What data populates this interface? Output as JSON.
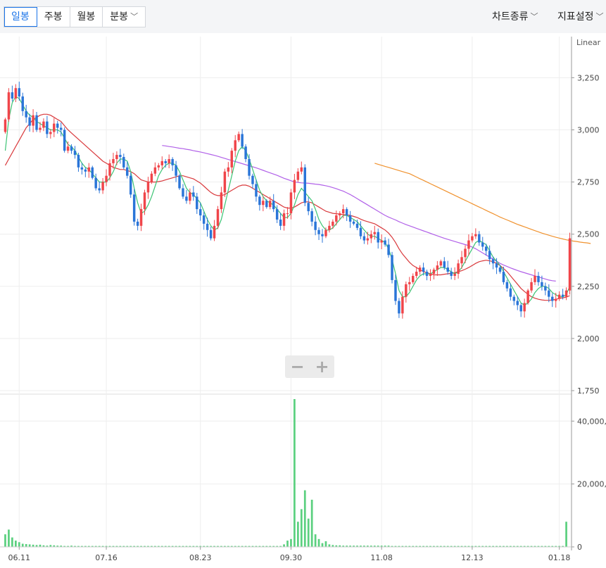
{
  "tabs": [
    {
      "label": "일봉",
      "active": true
    },
    {
      "label": "주봉",
      "active": false
    },
    {
      "label": "월봉",
      "active": false
    },
    {
      "label": "분봉",
      "active": false,
      "dropdown": true
    }
  ],
  "right_menu": {
    "chart_type": "차트종류",
    "indicator": "지표설정"
  },
  "zoom": {
    "minus": "−",
    "plus": "+"
  },
  "colors": {
    "up": "#f0454a",
    "down": "#2a75d8",
    "ma5": "#3cc474",
    "ma20": "#d9393c",
    "ma60": "#b161e8",
    "ma120": "#f0922e",
    "volume": "#5bd07f",
    "grid": "#eeeeee"
  },
  "chart_data": {
    "type": "candlestick",
    "scale_label": "Linear",
    "price_axis": {
      "ticks": [
        "3,250",
        "3,000",
        "2,750",
        "2,500",
        "2,250",
        "2,000",
        "1,750"
      ],
      "tick_values": [
        3250,
        3000,
        2750,
        2500,
        2250,
        2000,
        1750
      ],
      "ylim": [
        1750,
        3420
      ]
    },
    "volume_axis": {
      "ticks": [
        "40,000,000",
        "20,000,000",
        "0"
      ],
      "tick_values": [
        40000000,
        20000000,
        0
      ],
      "ylim": [
        0,
        47000000
      ]
    },
    "x_ticks": [
      {
        "label": "06.11",
        "index": 4
      },
      {
        "label": "07.16",
        "index": 29
      },
      {
        "label": "08.23",
        "index": 56
      },
      {
        "label": "09.30",
        "index": 82
      },
      {
        "label": "11.08",
        "index": 108
      },
      {
        "label": "12.13",
        "index": 134
      },
      {
        "label": "01.18",
        "index": 159
      }
    ],
    "closes": [
      3050,
      3180,
      3150,
      3200,
      3160,
      3090,
      3060,
      3020,
      3070,
      3000,
      3010,
      3040,
      2980,
      2990,
      3030,
      3010,
      3000,
      2900,
      2920,
      2900,
      2880,
      2820,
      2810,
      2800,
      2820,
      2770,
      2720,
      2710,
      2750,
      2780,
      2840,
      2860,
      2880,
      2870,
      2820,
      2780,
      2690,
      2560,
      2540,
      2620,
      2700,
      2750,
      2790,
      2820,
      2830,
      2850,
      2840,
      2860,
      2830,
      2780,
      2720,
      2680,
      2660,
      2700,
      2680,
      2620,
      2590,
      2550,
      2520,
      2480,
      2540,
      2620,
      2700,
      2800,
      2820,
      2900,
      2950,
      2980,
      2920,
      2860,
      2780,
      2740,
      2680,
      2640,
      2660,
      2630,
      2660,
      2620,
      2570,
      2540,
      2600,
      2600,
      2700,
      2760,
      2800,
      2820,
      2650,
      2610,
      2560,
      2520,
      2500,
      2490,
      2520,
      2540,
      2560,
      2590,
      2600,
      2620,
      2590,
      2560,
      2550,
      2530,
      2490,
      2470,
      2480,
      2500,
      2510,
      2460,
      2470,
      2450,
      2400,
      2280,
      2180,
      2120,
      2200,
      2260,
      2270,
      2300,
      2320,
      2340,
      2320,
      2300,
      2310,
      2330,
      2350,
      2370,
      2340,
      2320,
      2300,
      2310,
      2360,
      2390,
      2430,
      2470,
      2490,
      2500,
      2460,
      2440,
      2420,
      2380,
      2360,
      2340,
      2320,
      2270,
      2240,
      2200,
      2180,
      2160,
      2130,
      2170,
      2230,
      2270,
      2300,
      2270,
      2250,
      2230,
      2200,
      2180,
      2190,
      2210,
      2200,
      2230,
      2480
    ],
    "ma5": [
      2900,
      3050,
      3130,
      3160,
      3150,
      3120,
      3090,
      3070,
      3060,
      3040,
      3030,
      3020,
      3010,
      3000,
      3000,
      3000,
      2990,
      2960,
      2930,
      2920,
      2900,
      2870,
      2840,
      2820,
      2810,
      2790,
      2770,
      2750,
      2750,
      2750,
      2770,
      2800,
      2840,
      2860,
      2860,
      2850,
      2800,
      2720,
      2650,
      2600,
      2610,
      2640,
      2680,
      2730,
      2780,
      2810,
      2830,
      2840,
      2840,
      2830,
      2800,
      2760,
      2720,
      2700,
      2690,
      2670,
      2650,
      2610,
      2570,
      2540,
      2520,
      2530,
      2570,
      2640,
      2710,
      2780,
      2850,
      2900,
      2920,
      2900,
      2860,
      2810,
      2760,
      2710,
      2680,
      2660,
      2650,
      2640,
      2620,
      2600,
      2580,
      2580,
      2600,
      2640,
      2690,
      2720,
      2700,
      2680,
      2660,
      2620,
      2570,
      2540,
      2520,
      2520,
      2530,
      2550,
      2570,
      2590,
      2590,
      2580,
      2570,
      2560,
      2540,
      2520,
      2500,
      2490,
      2490,
      2480,
      2470,
      2460,
      2430,
      2380,
      2310,
      2230,
      2200,
      2200,
      2220,
      2250,
      2280,
      2300,
      2310,
      2310,
      2310,
      2320,
      2330,
      2340,
      2340,
      2330,
      2320,
      2310,
      2320,
      2340,
      2370,
      2400,
      2430,
      2460,
      2470,
      2460,
      2450,
      2420,
      2390,
      2370,
      2350,
      2320,
      2290,
      2260,
      2230,
      2200,
      2170,
      2160,
      2170,
      2190,
      2220,
      2240,
      2250,
      2250,
      2240,
      2220,
      2210,
      2200,
      2200,
      2210,
      2250
    ],
    "ma20": [
      2830,
      2860,
      2890,
      2920,
      2950,
      2980,
      3010,
      3030,
      3050,
      3060,
      3070,
      3075,
      3075,
      3070,
      3060,
      3050,
      3040,
      3020,
      3000,
      2985,
      2970,
      2955,
      2940,
      2925,
      2910,
      2895,
      2880,
      2865,
      2850,
      2840,
      2830,
      2820,
      2815,
      2810,
      2810,
      2805,
      2800,
      2790,
      2775,
      2760,
      2755,
      2750,
      2750,
      2750,
      2752,
      2755,
      2760,
      2765,
      2770,
      2775,
      2780,
      2780,
      2775,
      2770,
      2765,
      2755,
      2745,
      2730,
      2715,
      2700,
      2690,
      2685,
      2685,
      2690,
      2700,
      2710,
      2720,
      2730,
      2735,
      2735,
      2730,
      2720,
      2710,
      2700,
      2690,
      2680,
      2670,
      2660,
      2650,
      2640,
      2630,
      2625,
      2625,
      2630,
      2640,
      2650,
      2655,
      2655,
      2650,
      2640,
      2630,
      2620,
      2610,
      2605,
      2600,
      2598,
      2596,
      2594,
      2592,
      2590,
      2585,
      2580,
      2572,
      2565,
      2560,
      2555,
      2550,
      2540,
      2530,
      2520,
      2505,
      2485,
      2460,
      2430,
      2405,
      2385,
      2365,
      2350,
      2340,
      2330,
      2320,
      2315,
      2310,
      2305,
      2305,
      2305,
      2308,
      2310,
      2312,
      2315,
      2320,
      2325,
      2332,
      2340,
      2350,
      2360,
      2368,
      2372,
      2375,
      2372,
      2368,
      2360,
      2350,
      2335,
      2320,
      2300,
      2280,
      2260,
      2240,
      2225,
      2212,
      2200,
      2193,
      2188,
      2185,
      2183,
      2183,
      2185,
      2188,
      2192,
      2195,
      2198,
      2205
    ],
    "ma60": [
      null,
      null,
      null,
      null,
      null,
      null,
      null,
      null,
      null,
      null,
      null,
      null,
      null,
      null,
      null,
      null,
      null,
      null,
      null,
      null,
      null,
      null,
      null,
      null,
      null,
      null,
      null,
      null,
      null,
      null,
      null,
      null,
      null,
      null,
      null,
      null,
      null,
      null,
      null,
      null,
      null,
      null,
      null,
      null,
      null,
      2925,
      2923,
      2920,
      2918,
      2915,
      2912,
      2910,
      2907,
      2904,
      2900,
      2897,
      2894,
      2890,
      2886,
      2882,
      2878,
      2873,
      2868,
      2863,
      2858,
      2853,
      2848,
      2843,
      2838,
      2833,
      2828,
      2823,
      2818,
      2812,
      2806,
      2800,
      2794,
      2788,
      2782,
      2775,
      2768,
      2762,
      2756,
      2750,
      2748,
      2746,
      2745,
      2744,
      2742,
      2740,
      2738,
      2735,
      2732,
      2728,
      2723,
      2718,
      2712,
      2706,
      2698,
      2690,
      2680,
      2670,
      2660,
      2650,
      2640,
      2630,
      2620,
      2610,
      2600,
      2590,
      2582,
      2575,
      2568,
      2560,
      2553,
      2546,
      2540,
      2534,
      2528,
      2522,
      2516,
      2510,
      2504,
      2498,
      2492,
      2486,
      2480,
      2475,
      2470,
      2465,
      2460,
      2455,
      2450,
      2445,
      2438,
      2430,
      2420,
      2410,
      2400,
      2390,
      2380,
      2370,
      2360,
      2352,
      2345,
      2338,
      2332,
      2326,
      2320,
      2315,
      2310,
      2305,
      2300,
      2295,
      2290,
      2285,
      2280,
      2277,
      2275
    ],
    "ma120": [
      null,
      null,
      null,
      null,
      null,
      null,
      null,
      null,
      null,
      null,
      null,
      null,
      null,
      null,
      null,
      null,
      null,
      null,
      null,
      null,
      null,
      null,
      null,
      null,
      null,
      null,
      null,
      null,
      null,
      null,
      null,
      null,
      null,
      null,
      null,
      null,
      null,
      null,
      null,
      null,
      null,
      null,
      null,
      null,
      null,
      null,
      null,
      null,
      null,
      null,
      null,
      null,
      null,
      null,
      null,
      null,
      null,
      null,
      null,
      null,
      null,
      null,
      null,
      null,
      null,
      null,
      null,
      null,
      null,
      null,
      null,
      null,
      null,
      null,
      null,
      null,
      null,
      null,
      null,
      null,
      null,
      null,
      null,
      null,
      null,
      null,
      null,
      null,
      null,
      null,
      null,
      null,
      null,
      null,
      null,
      null,
      null,
      null,
      null,
      null,
      null,
      null,
      null,
      null,
      null,
      null,
      2840,
      2835,
      2830,
      2825,
      2820,
      2815,
      2810,
      2805,
      2800,
      2795,
      2790,
      2782,
      2774,
      2766,
      2758,
      2750,
      2742,
      2734,
      2726,
      2718,
      2710,
      2702,
      2694,
      2686,
      2678,
      2670,
      2662,
      2654,
      2646,
      2638,
      2630,
      2622,
      2614,
      2606,
      2598,
      2590,
      2582,
      2575,
      2568,
      2561,
      2554,
      2547,
      2541,
      2535,
      2529,
      2523,
      2517,
      2511,
      2505,
      2500,
      2495,
      2490,
      2485,
      2481,
      2477,
      2473,
      2470,
      2467,
      2465,
      2462,
      2460,
      2458,
      2455
    ],
    "volume": [
      4000000,
      5500000,
      3000000,
      2000000,
      1500000,
      1000000,
      900000,
      800000,
      700000,
      600000,
      700000,
      500000,
      400000,
      600000,
      500000,
      400000,
      400000,
      300000,
      300000,
      400000,
      300000,
      300000,
      300000,
      300000,
      300000,
      300000,
      300000,
      300000,
      300000,
      300000,
      300000,
      300000,
      300000,
      300000,
      300000,
      300000,
      300000,
      300000,
      300000,
      300000,
      300000,
      300000,
      300000,
      300000,
      300000,
      300000,
      300000,
      300000,
      300000,
      300000,
      300000,
      300000,
      300000,
      300000,
      300000,
      300000,
      300000,
      300000,
      300000,
      300000,
      300000,
      300000,
      300000,
      300000,
      300000,
      300000,
      300000,
      300000,
      300000,
      300000,
      300000,
      300000,
      300000,
      300000,
      300000,
      300000,
      300000,
      300000,
      300000,
      300000,
      800000,
      2000000,
      2500000,
      47000000,
      8000000,
      12000000,
      18000000,
      9000000,
      15000000,
      4000000,
      2500000,
      1200000,
      1800000,
      800000,
      600000,
      500000,
      500000,
      400000,
      400000,
      400000,
      400000,
      400000,
      400000,
      400000,
      400000,
      400000,
      400000,
      400000,
      400000,
      400000,
      400000,
      300000,
      300000,
      300000,
      300000,
      300000,
      300000,
      300000,
      300000,
      300000,
      300000,
      300000,
      300000,
      300000,
      300000,
      300000,
      300000,
      300000,
      300000,
      300000,
      300000,
      300000,
      300000,
      300000,
      300000,
      300000,
      300000,
      300000,
      300000,
      300000,
      300000,
      300000,
      300000,
      300000,
      300000,
      300000,
      300000,
      300000,
      300000,
      300000,
      300000,
      300000,
      300000,
      300000,
      300000,
      300000,
      300000,
      300000,
      300000,
      300000,
      300000,
      8000000
    ]
  }
}
